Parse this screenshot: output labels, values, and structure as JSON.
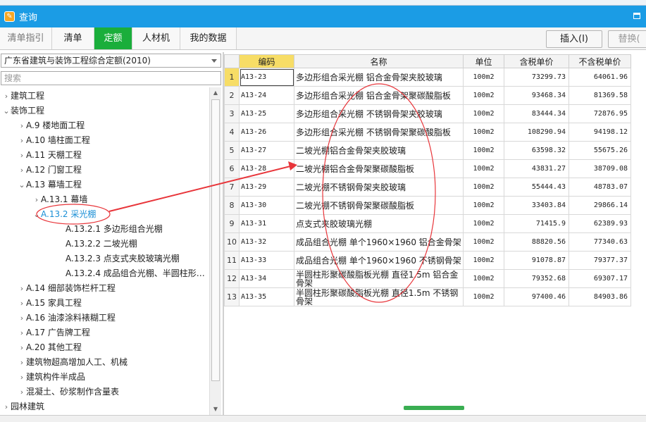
{
  "window": {
    "title": "查询"
  },
  "tabs": [
    {
      "label": "清单指引"
    },
    {
      "label": "清单"
    },
    {
      "label": "定额"
    },
    {
      "label": "人材机"
    },
    {
      "label": "我的数据"
    }
  ],
  "toolbar": {
    "insert_label": "插入(I)",
    "replace_label": "替换("
  },
  "left": {
    "combo_value": "广东省建筑与装饰工程综合定额(2010)",
    "search_placeholder": "搜索",
    "tree": [
      {
        "label": "建筑工程",
        "arrow": "›"
      },
      {
        "label": "装饰工程",
        "arrow": "⌄"
      },
      {
        "label": "A.9 楼地面工程",
        "arrow": "›"
      },
      {
        "label": "A.10 墙柱面工程",
        "arrow": "›"
      },
      {
        "label": "A.11 天棚工程",
        "arrow": "›"
      },
      {
        "label": "A.12 门窗工程",
        "arrow": "›"
      },
      {
        "label": "A.13 幕墙工程",
        "arrow": "⌄"
      },
      {
        "label": "A.13.1 幕墙",
        "arrow": "›"
      },
      {
        "label": "A.13.2 采光棚",
        "arrow": "⌄"
      },
      {
        "label": "A.13.2.1 多边形组合光棚",
        "arrow": ""
      },
      {
        "label": "A.13.2.2 二坡光棚",
        "arrow": ""
      },
      {
        "label": "A.13.2.3 点支式夹胶玻璃光棚",
        "arrow": ""
      },
      {
        "label": "A.13.2.4 成品组合光棚、半圆柱形…",
        "arrow": ""
      },
      {
        "label": "A.14 细部装饰栏杆工程",
        "arrow": "›"
      },
      {
        "label": "A.15 家具工程",
        "arrow": "›"
      },
      {
        "label": "A.16 油漆涂料裱糊工程",
        "arrow": "›"
      },
      {
        "label": "A.17 广告牌工程",
        "arrow": "›"
      },
      {
        "label": "A.20 其他工程",
        "arrow": "›"
      },
      {
        "label": "建筑物超高增加人工、机械",
        "arrow": "›"
      },
      {
        "label": "建筑构件半成品",
        "arrow": "›"
      },
      {
        "label": "混凝土、砂浆制作含量表",
        "arrow": "›"
      },
      {
        "label": "园林建筑",
        "arrow": "›"
      }
    ]
  },
  "table": {
    "headers": [
      "编码",
      "名称",
      "单位",
      "含税单价",
      "不含税单价"
    ],
    "rows": [
      {
        "n": "1",
        "code": "A13-23",
        "name": "多边形组合采光棚 铝合金骨架夹胶玻璃",
        "unit": "100m2",
        "price_tax": "73299.73",
        "price_notax": "64061.96"
      },
      {
        "n": "2",
        "code": "A13-24",
        "name": "多边形组合采光棚 铝合金骨架聚碳酸脂板",
        "unit": "100m2",
        "price_tax": "93468.34",
        "price_notax": "81369.58"
      },
      {
        "n": "3",
        "code": "A13-25",
        "name": "多边形组合采光棚 不锈钢骨架夹胶玻璃",
        "unit": "100m2",
        "price_tax": "83444.34",
        "price_notax": "72876.95"
      },
      {
        "n": "4",
        "code": "A13-26",
        "name": "多边形组合采光棚 不锈钢骨架聚碳酸脂板",
        "unit": "100m2",
        "price_tax": "108290.94",
        "price_notax": "94198.12"
      },
      {
        "n": "5",
        "code": "A13-27",
        "name": "二坡光棚铝合金骨架夹胶玻璃",
        "unit": "100m2",
        "price_tax": "63598.32",
        "price_notax": "55675.26"
      },
      {
        "n": "6",
        "code": "A13-28",
        "name": "二坡光棚铝合金骨架聚碳酸脂板",
        "unit": "100m2",
        "price_tax": "43831.27",
        "price_notax": "38709.08"
      },
      {
        "n": "7",
        "code": "A13-29",
        "name": "二坡光棚不锈钢骨架夹胶玻璃",
        "unit": "100m2",
        "price_tax": "55444.43",
        "price_notax": "48783.07"
      },
      {
        "n": "8",
        "code": "A13-30",
        "name": "二坡光棚不锈钢骨架聚碳酸脂板",
        "unit": "100m2",
        "price_tax": "33403.84",
        "price_notax": "29866.14"
      },
      {
        "n": "9",
        "code": "A13-31",
        "name": "点支式夹胶玻璃光棚",
        "unit": "100m2",
        "price_tax": "71415.9",
        "price_notax": "62389.93"
      },
      {
        "n": "10",
        "code": "A13-32",
        "name": "成品组合光棚 单个1960×1960 铝合金骨架",
        "unit": "100m2",
        "price_tax": "88820.56",
        "price_notax": "77340.63"
      },
      {
        "n": "11",
        "code": "A13-33",
        "name": "成品组合光棚 单个1960×1960 不锈钢骨架",
        "unit": "100m2",
        "price_tax": "91078.87",
        "price_notax": "79377.37"
      },
      {
        "n": "12",
        "code": "A13-34",
        "name": "半圆柱形聚碳酸脂板光棚 直径1.5m 铝合金骨架",
        "unit": "100m2",
        "price_tax": "79352.68",
        "price_notax": "69307.17"
      },
      {
        "n": "13",
        "code": "A13-35",
        "name": "半圆柱形聚碳酸脂板光棚 直径1.5m 不锈钢骨架",
        "unit": "100m2",
        "price_tax": "97400.46",
        "price_notax": "84903.86"
      }
    ]
  },
  "colors": {
    "titlebar": "#1b9ce5",
    "active_tab": "#1aae3b",
    "header_highlight": "#f7dd66",
    "annotation": "#e8353a",
    "selected_node": "#1a8fd6"
  }
}
